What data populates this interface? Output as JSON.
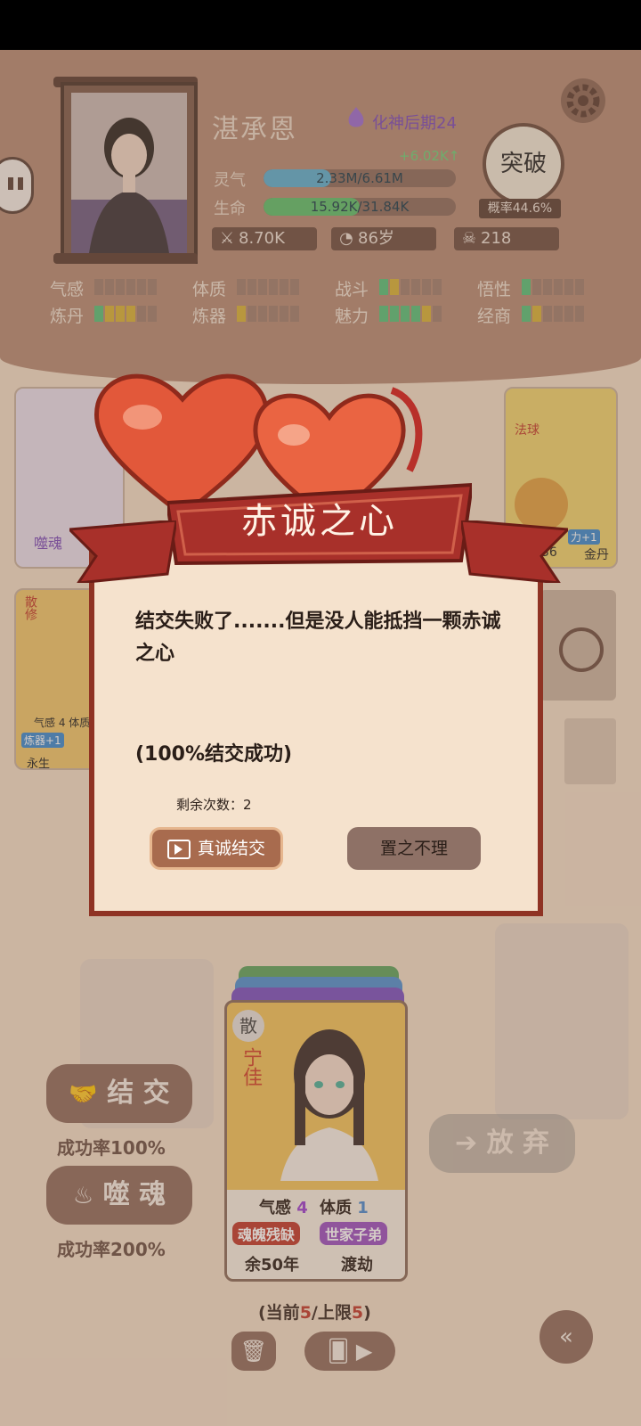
{
  "player": {
    "name": "湛承恩",
    "realm": "化神后期24",
    "spirit_gain": "+6.02K↑",
    "spirit_label": "灵气",
    "spirit_value": "2.33M/6.61M",
    "spirit_ratio": 0.352,
    "life_label": "生命",
    "life_value": "15.92K/31.84K",
    "life_ratio": 0.5,
    "stats": [
      {
        "icon": "attack-icon",
        "value": "8.70K"
      },
      {
        "icon": "age-icon",
        "value": "86岁"
      },
      {
        "icon": "skull-icon",
        "value": "218"
      }
    ],
    "breakthrough_label": "突破",
    "breakthrough_prob": "概率44.6%",
    "attributes": [
      {
        "name": "气感",
        "green": 0,
        "yellow": 0
      },
      {
        "name": "体质",
        "green": 0,
        "yellow": 0
      },
      {
        "name": "战斗",
        "green": 1,
        "yellow": 1
      },
      {
        "name": "悟性",
        "green": 1,
        "yellow": 0
      },
      {
        "name": "炼丹",
        "green": 1,
        "yellow": 3
      },
      {
        "name": "炼器",
        "green": 0,
        "yellow": 1
      },
      {
        "name": "魅力",
        "green": 4,
        "yellow": 1
      },
      {
        "name": "经商",
        "green": 1,
        "yellow": 1
      }
    ]
  },
  "background_cards": {
    "card1_label": "噬魂",
    "card2_tag": "法球",
    "card2_bonus": "力+1",
    "card2_num": "36",
    "card2_item": "金丹",
    "card3_title": "散修",
    "card3_attrs": "气感 4 体质",
    "card3_tag": "炼器+1",
    "card3_bottom": "永生"
  },
  "dialog": {
    "title": "赤诚之心",
    "message": "结交失败了.......但是没人能抵挡一颗赤诚之心",
    "success_text": "(100%结交成功)",
    "remaining": "剩余次数：2",
    "sincere_button": "真诚结交",
    "ignore_button": "置之不理"
  },
  "candidate": {
    "badge": "散",
    "name": "宁佳",
    "attr1_label": "气感",
    "attr1_value": "4",
    "attr2_label": "体质",
    "attr2_value": "1",
    "trait1": "魂魄残缺",
    "trait2": "世家子弟",
    "lifespan": "余50年",
    "stage": "渡劫"
  },
  "actions": {
    "befriend_label": "结 交",
    "befriend_rate": "成功率100%",
    "devour_label": "噬 魂",
    "devour_rate": "成功率200%",
    "abandon_label": "放 弃"
  },
  "capacity": {
    "prefix": "(当前",
    "current": "5",
    "middle": "/上限",
    "limit": "5",
    "suffix": ")"
  },
  "colors": {
    "spirit_bar": "#5aaed0",
    "life_bar": "#5cbf6a",
    "banner_red": "#a8302a",
    "dialog_border": "#8f3324"
  }
}
